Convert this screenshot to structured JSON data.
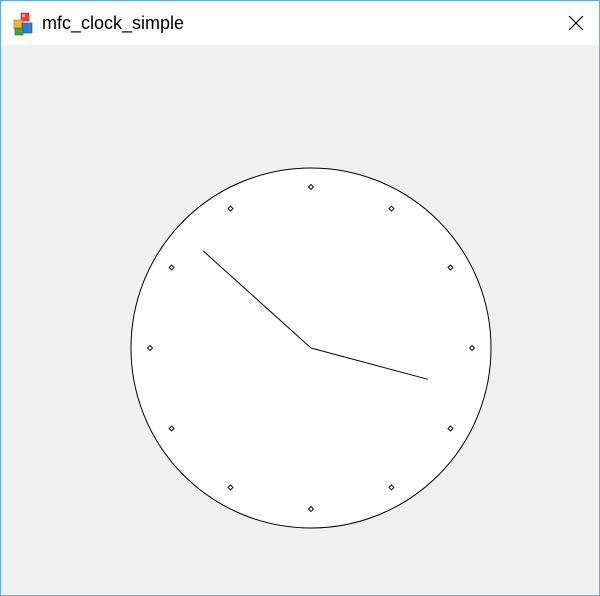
{
  "window": {
    "title": "mfc_clock_simple",
    "app_icon": "mfc-app-icon",
    "close_icon": "close-icon"
  },
  "colors": {
    "client_background": "#f0f0f0",
    "clock_face": "#ffffff",
    "clock_outline": "#000000",
    "window_border": "#6fa8dc"
  },
  "clock": {
    "time_shown": {
      "hour": 3.5,
      "minute": 52
    },
    "hour_markers": 12
  }
}
